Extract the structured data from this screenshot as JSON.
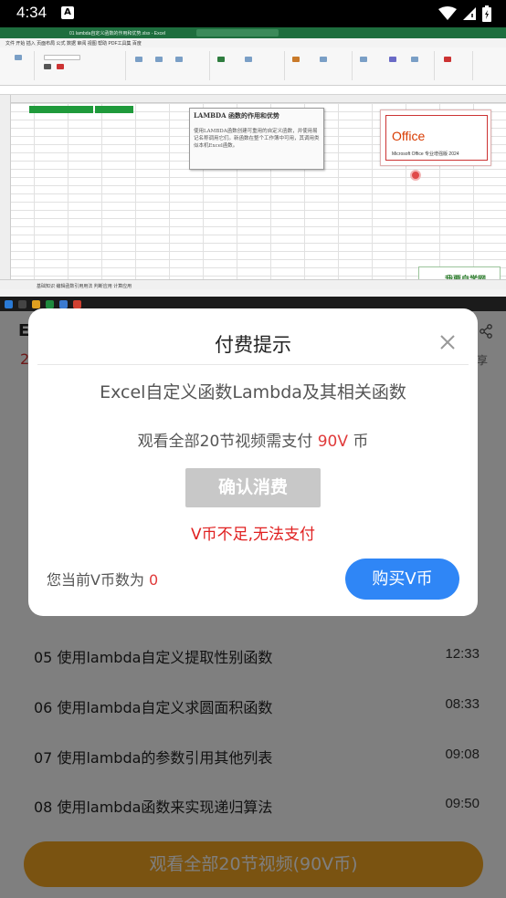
{
  "status_bar": {
    "time": "4:34",
    "notif_icon": "A"
  },
  "video": {
    "excel_window_title": "01 lambda自定义函数的作用和优势.xlsx - Excel",
    "excel_menu": "文件  开始  插入  页面布局  公式  数据  审阅  视图  帮助  PDF工具集  百度",
    "note_title": "LAMBDA 函数的作用和优势",
    "note_body": "使用LAMBDA函数创建可重用的自定义函数，并使用易记名称调用它们。新函数在整个工作簿中可用，其调用类似本机Excel函数。",
    "office_brand": "Office",
    "office_edition": "Microsoft Office 专业增强版 2024",
    "sheet_tabs": "基础知识  编辑函数引用用法  判断应用  计算应用",
    "channel_logo": "我要自学网"
  },
  "course_peek": {
    "title_initial": "E",
    "count_initial": "2",
    "share_label": "享"
  },
  "lessons": [
    {
      "title": "05 使用lambda自定义提取性别函数",
      "duration": "12:33"
    },
    {
      "title": "06 使用lambda自定义求圆面积函数",
      "duration": "08:33"
    },
    {
      "title": "07 使用lambda的参数引用其他列表",
      "duration": "09:08"
    },
    {
      "title": "08 使用lambda函数来实现递归算法",
      "duration": "09:50"
    }
  ],
  "watch_all_button": "观看全部20节视频(90V币)",
  "dialog": {
    "title": "付费提示",
    "course_name": "Excel自定义函数Lambda及其相关函数",
    "price_prefix": "观看全部20节视频需支付 ",
    "price_amount": "90V",
    "price_suffix": " 币",
    "confirm_button": "确认消费",
    "error_message": "V币不足,无法支付",
    "balance_label": "您当前V币数为 ",
    "balance_value": "0",
    "buy_button": "购买V币"
  },
  "colors": {
    "accent_blue": "#2f86f6",
    "error_red": "#e02020",
    "watch_button_orange": "#f5a623",
    "excel_green": "#1e6e3e"
  }
}
